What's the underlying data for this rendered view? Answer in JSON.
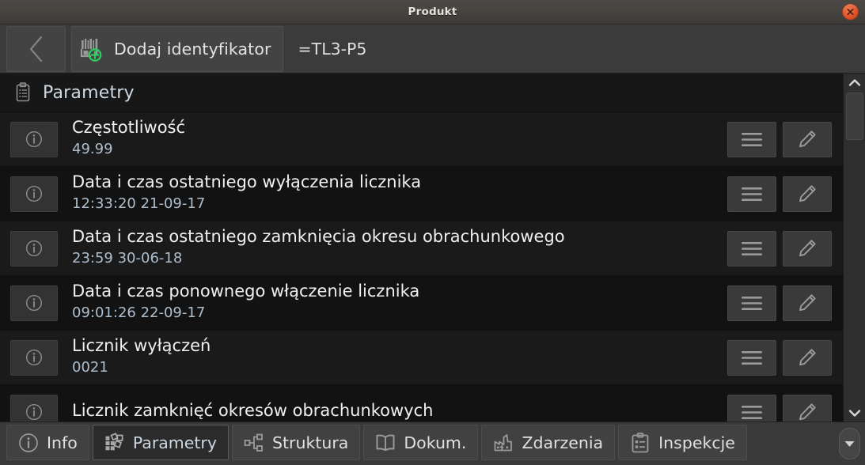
{
  "window": {
    "title": "Produkt",
    "close_label": "×"
  },
  "toolbar": {
    "back_icon": "chevron-left-icon",
    "add_button": {
      "label": "Dodaj identyfikator",
      "icon": "barcode-add-icon"
    },
    "identifier": "=TL3-P5"
  },
  "section": {
    "icon": "clipboard-list-icon",
    "title": "Parametry"
  },
  "rows": [
    {
      "label": "Częstotliwość",
      "value": "49.99"
    },
    {
      "label": "Data i czas ostatniego wyłączenia licznika",
      "value": "12:33:20 21-09-17"
    },
    {
      "label": "Data i czas ostatniego zamknięcia okresu obrachunkowego",
      "value": "23:59 30-06-18"
    },
    {
      "label": "Data i czas ponownego włączenie licznika",
      "value": "09:01:26 22-09-17"
    },
    {
      "label": "Licznik wyłączeń",
      "value": "0021"
    },
    {
      "label": "Licznik zamknięć okresów obrachunkowych",
      "value": ""
    }
  ],
  "row_actions": {
    "menu_icon": "hamburger-menu-icon",
    "edit_icon": "pencil-edit-icon",
    "info_icon": "info-circle-icon"
  },
  "scrollbar": {
    "up_icon": "chevron-up-icon",
    "down_icon": "chevron-down-icon"
  },
  "tabs": [
    {
      "label": "Info",
      "icon": "info-circle-icon",
      "active": false
    },
    {
      "label": "Parametry",
      "icon": "parameters-icon",
      "active": true
    },
    {
      "label": "Struktura",
      "icon": "structure-tree-icon",
      "active": false
    },
    {
      "label": "Dokum.",
      "icon": "book-icon",
      "active": false
    },
    {
      "label": "Zdarzenia",
      "icon": "factory-icon",
      "active": false
    },
    {
      "label": "Inspekcje",
      "icon": "clipboard-check-icon",
      "active": false
    }
  ],
  "tab_more": {
    "icon": "triangle-down-icon"
  },
  "colors": {
    "window_chrome": "#46443f",
    "toolbar_bg": "#3b3b3b",
    "list_bg": "#141414",
    "row_alt_bg": "#1a1a1a",
    "label_text": "#f0f0f0",
    "value_text": "#aebecd",
    "accent_green": "#2ecc5f",
    "close_red": "#e0552a"
  }
}
